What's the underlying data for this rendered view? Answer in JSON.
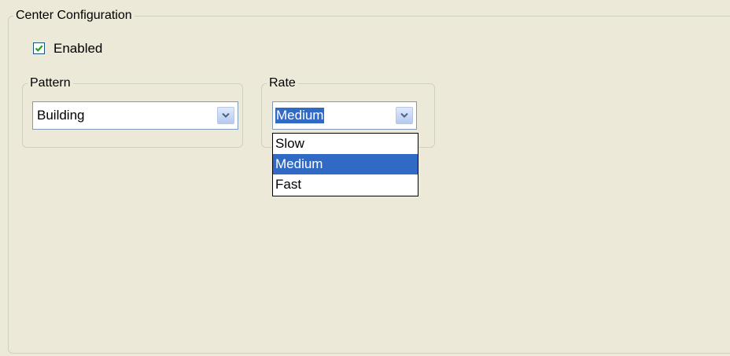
{
  "center_config": {
    "title": "Center Configuration",
    "enabled_label": "Enabled",
    "enabled_checked": true
  },
  "pattern": {
    "group_label": "Pattern",
    "selected_value": "Building"
  },
  "rate": {
    "group_label": "Rate",
    "selected_value": "Medium",
    "options": [
      "Slow",
      "Medium",
      "Fast"
    ],
    "highlighted_option": "Medium"
  },
  "icons": {
    "checkbox_check": "checkmark-icon",
    "dropdown_arrow": "chevron-down-icon"
  },
  "colors": {
    "background": "#ece9d8",
    "selection": "#316ac5",
    "check_green": "#21a121",
    "arrow_blue": "#4d6185"
  }
}
